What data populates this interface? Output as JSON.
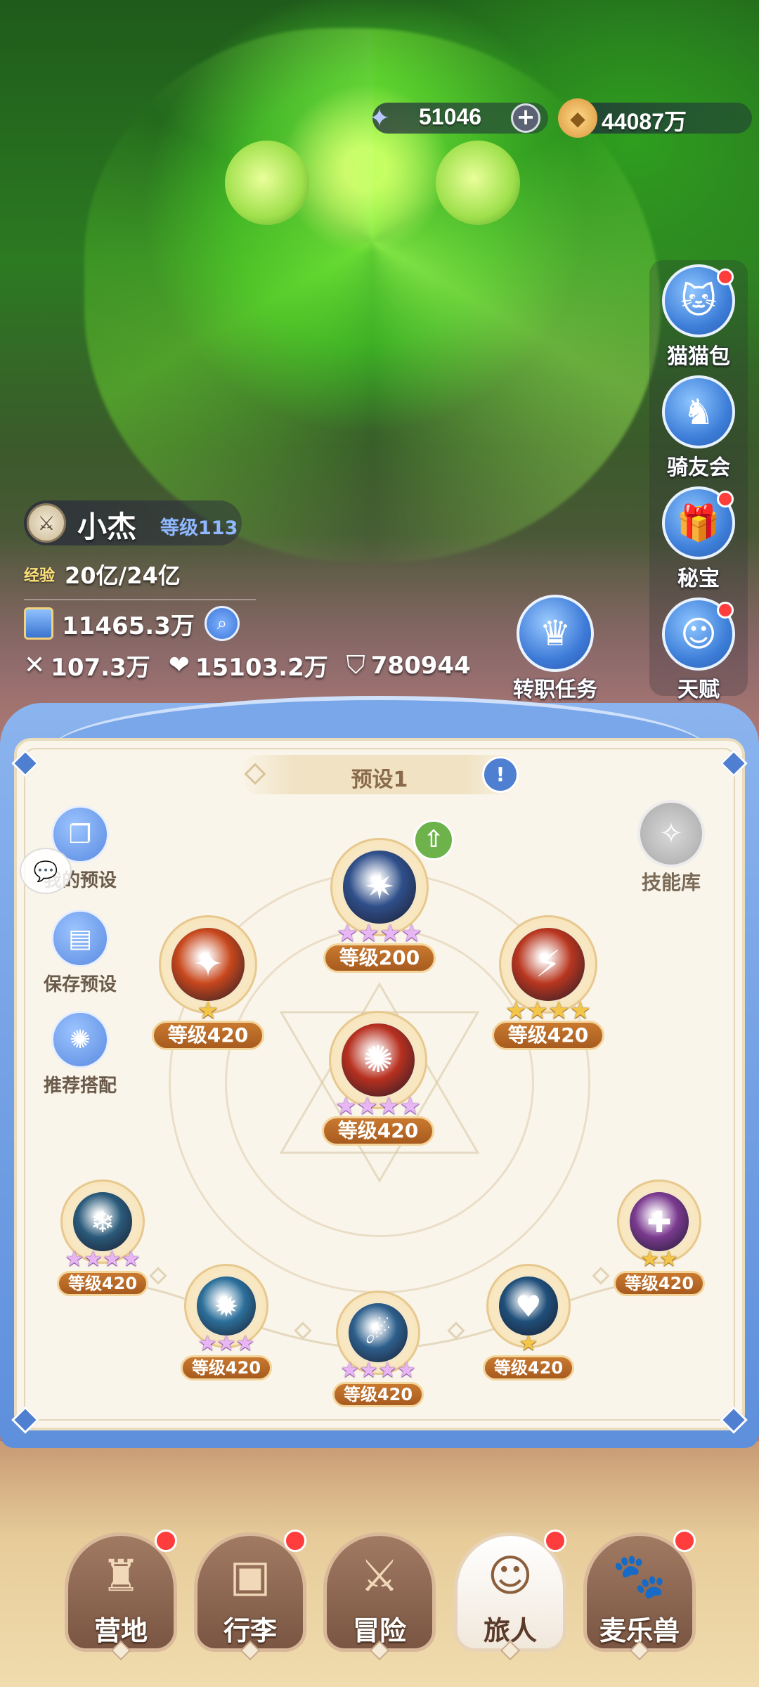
{
  "currency": {
    "gems": "51046",
    "gold": "44087万",
    "gem_icon": "star-crystal-icon",
    "gold_icon": "gold-coin-icon"
  },
  "right_menu": [
    {
      "label": "猫猫包",
      "icon": "cat-bag-icon",
      "badge": true
    },
    {
      "label": "骑友会",
      "icon": "horse-icon",
      "badge": false
    },
    {
      "label": "秘宝",
      "icon": "treasure-icon",
      "badge": true
    },
    {
      "label": "天赋",
      "icon": "brain-icon",
      "badge": true
    }
  ],
  "player": {
    "name": "小杰",
    "level": "等级113",
    "exp_label": "经验",
    "exp": "20亿/24亿",
    "power": "11465.3万",
    "attack": "107.3万",
    "hp": "15103.2万",
    "defense": "780944"
  },
  "job_task": {
    "label": "转职任务"
  },
  "panel": {
    "preset": "预设1",
    "left_buttons": [
      {
        "label": "我的预设"
      },
      {
        "label": "保存预设"
      },
      {
        "label": "推荐搭配"
      }
    ],
    "skill_library": "技能库",
    "skills": [
      {
        "id": "top",
        "level": "等级200",
        "stars": 4,
        "star_color": "pink",
        "color": "#2f4f8a",
        "upgrade": true
      },
      {
        "id": "left",
        "level": "等级420",
        "stars": 1,
        "star_color": "gold",
        "color": "#c7471c"
      },
      {
        "id": "right",
        "level": "等级420",
        "stars": 4,
        "star_color": "gold",
        "color": "#b8361f"
      },
      {
        "id": "center",
        "level": "等级420",
        "stars": 4,
        "star_color": "pink",
        "color": "#b7301f"
      },
      {
        "id": "b1",
        "level": "等级420",
        "stars": 4,
        "star_color": "pink",
        "color": "#2a5a7a"
      },
      {
        "id": "b2",
        "level": "等级420",
        "stars": 3,
        "star_color": "pink",
        "color": "#2c6f9a"
      },
      {
        "id": "b3",
        "level": "等级420",
        "stars": 4,
        "star_color": "pink",
        "color": "#2d5f8c"
      },
      {
        "id": "b4",
        "level": "等级420",
        "stars": 1,
        "star_color": "gold",
        "color": "#1f4f7a"
      },
      {
        "id": "b5",
        "level": "等级420",
        "stars": 2,
        "star_color": "gold",
        "color": "#7a3a8f"
      }
    ]
  },
  "bottom_nav": [
    {
      "label": "营地",
      "icon": "castle-icon",
      "badge": true,
      "active": false
    },
    {
      "label": "行李",
      "icon": "backpack-icon",
      "badge": true,
      "active": false
    },
    {
      "label": "冒险",
      "icon": "crossed-swords-icon",
      "badge": false,
      "active": false
    },
    {
      "label": "旅人",
      "icon": "traveler-avatar-icon",
      "badge": true,
      "active": true
    },
    {
      "label": "麦乐兽",
      "icon": "pet-icon",
      "badge": true,
      "active": false
    }
  ]
}
